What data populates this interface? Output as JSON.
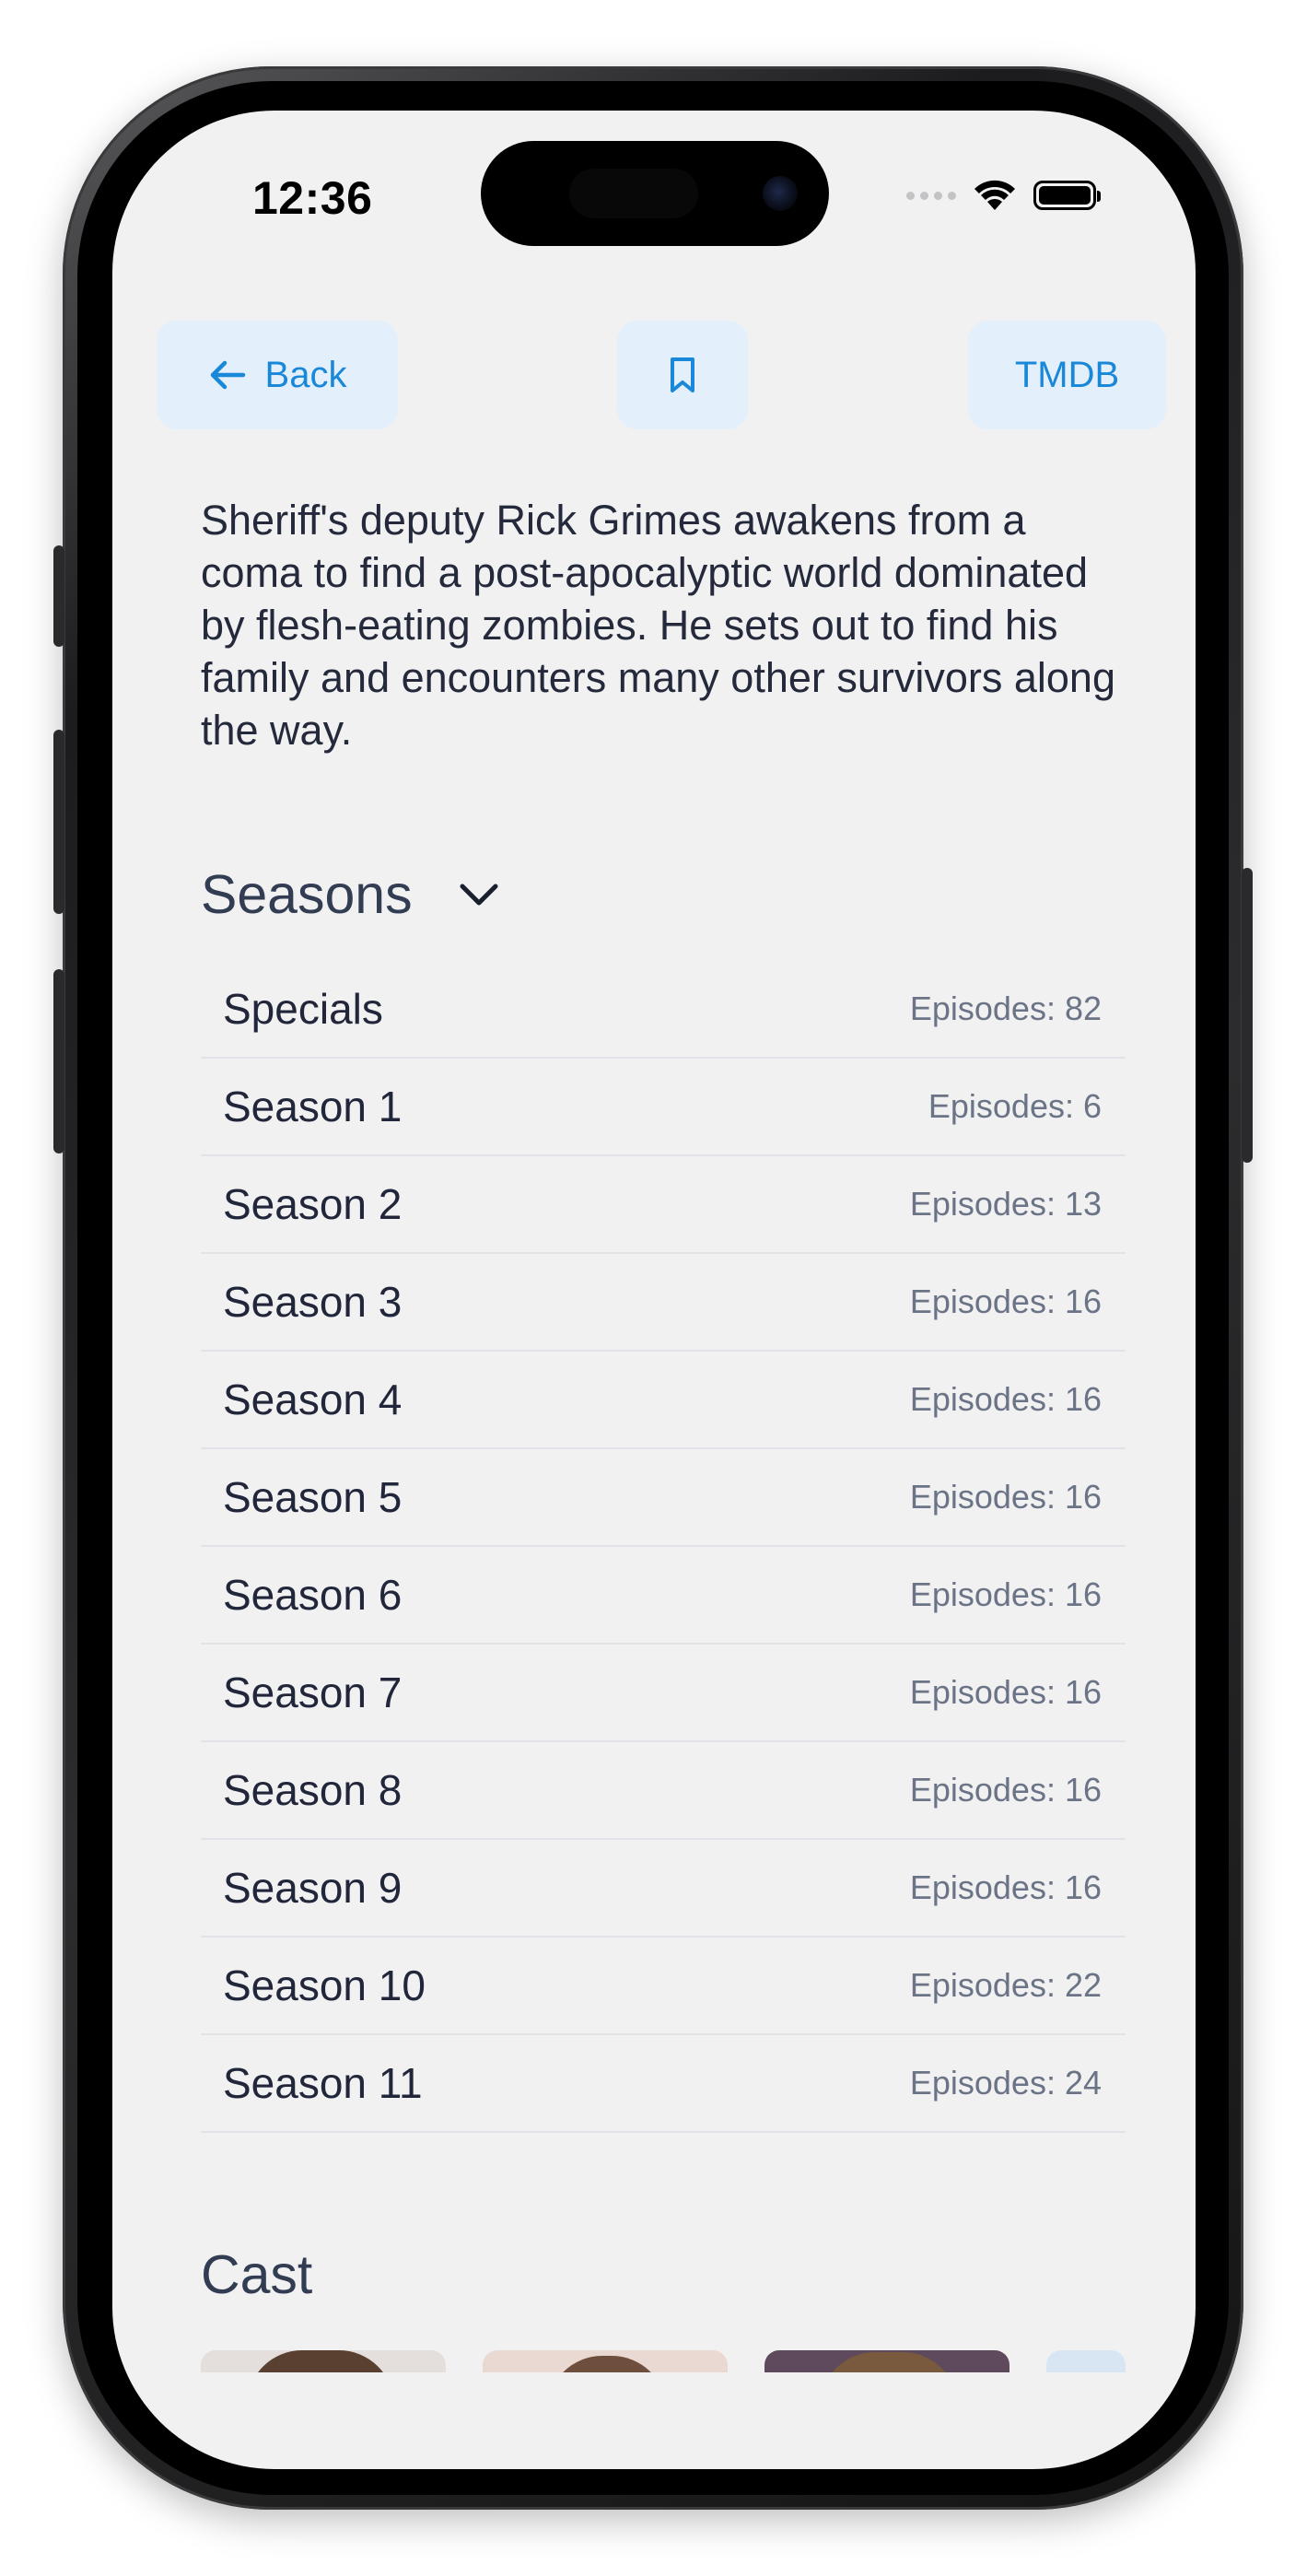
{
  "status_bar": {
    "time": "12:36"
  },
  "nav": {
    "back_label": "Back",
    "tmdb_label": "TMDB",
    "back_icon": "arrow-left-icon",
    "bookmark_icon": "bookmark-icon"
  },
  "overview": "Sheriff's deputy Rick Grimes awakens from a coma to find a post-apocalyptic world dominated by flesh-eating zombies. He sets out to find his family and encounters many other survivors along the way.",
  "seasons": {
    "title": "Seasons",
    "toggle_icon": "chevron-down-icon",
    "items": [
      {
        "name": "Specials",
        "episodes": "Episodes: 82"
      },
      {
        "name": "Season 1",
        "episodes": "Episodes: 6"
      },
      {
        "name": "Season 2",
        "episodes": "Episodes: 13"
      },
      {
        "name": "Season 3",
        "episodes": "Episodes: 16"
      },
      {
        "name": "Season 4",
        "episodes": "Episodes: 16"
      },
      {
        "name": "Season 5",
        "episodes": "Episodes: 16"
      },
      {
        "name": "Season 6",
        "episodes": "Episodes: 16"
      },
      {
        "name": "Season 7",
        "episodes": "Episodes: 16"
      },
      {
        "name": "Season 8",
        "episodes": "Episodes: 16"
      },
      {
        "name": "Season 9",
        "episodes": "Episodes: 16"
      },
      {
        "name": "Season 10",
        "episodes": "Episodes: 22"
      },
      {
        "name": "Season 11",
        "episodes": "Episodes: 24"
      }
    ]
  },
  "cast": {
    "title": "Cast"
  },
  "colors": {
    "accent": "#1a88d8",
    "button_bg": "#e3effa",
    "screen_bg": "#f1f1f2",
    "text": "#21263a",
    "muted": "#6b7486"
  }
}
